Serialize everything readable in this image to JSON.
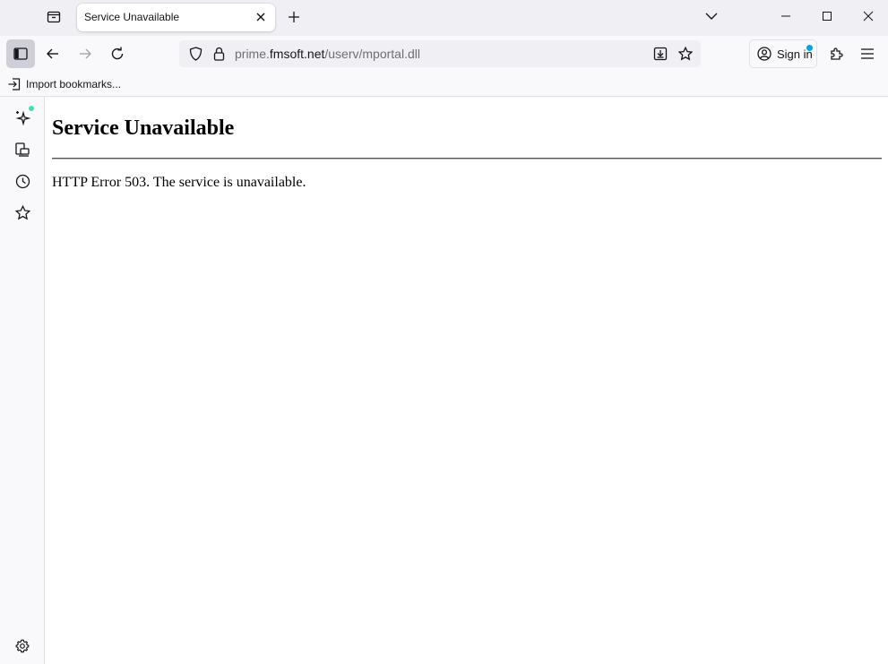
{
  "tab": {
    "title": "Service Unavailable"
  },
  "urlbar": {
    "prefix": "prime.",
    "host": "fmsoft.net",
    "path": "/userv/mportal.dll"
  },
  "account": {
    "sign_in_label": "Sign in"
  },
  "bookmarks_toolbar": {
    "import_label": "Import bookmarks..."
  },
  "page": {
    "heading": "Service Unavailable",
    "message": "HTTP Error 503. The service is unavailable."
  },
  "icons": {
    "tab_list": "tab-list-icon",
    "tab_close": "close-icon",
    "new_tab": "plus-icon",
    "list_all_tabs": "chevron-down-icon",
    "minimize": "minimize-icon",
    "maximize": "maximize-icon",
    "close_window": "close-icon",
    "sidebar_toggle": "sidebar-icon",
    "back": "back-arrow-icon",
    "forward": "forward-arrow-icon",
    "reload": "reload-icon",
    "tracking_protection": "shield-icon",
    "security": "lock-icon",
    "save_to_pocket": "download-icon",
    "bookmark_page": "star-icon",
    "account": "account-icon",
    "extensions": "puzzle-icon",
    "app_menu": "hamburger-icon",
    "import_bookmarks": "import-icon",
    "ai_chatbot": "sparkle-icon",
    "synced_tabs": "synced-tabs-icon",
    "history": "clock-icon",
    "bookmarks": "star-icon",
    "customize_sidebar": "gear-icon"
  },
  "colors": {
    "notification_dot": "#00a8e0",
    "ai_dot": "#3fe1b0"
  }
}
